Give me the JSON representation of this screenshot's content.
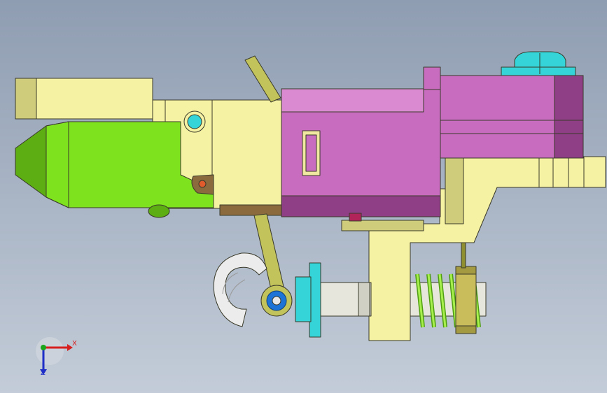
{
  "viewport": {
    "background_top": "#8f9db2",
    "background_bottom": "#c3ccd8"
  },
  "colors": {
    "yellow": "#f6f2a4",
    "yellow_dark": "#cfcc7c",
    "green": "#7fe21e",
    "green_dark": "#5cae12",
    "magenta": "#c86cbf",
    "magenta_dark": "#8e3f85",
    "magenta_light": "#d98ad1",
    "olive": "#c2c35a",
    "olive_dark": "#8f8f30",
    "cyan": "#34d4d8",
    "cyan_dark": "#1a9aa2",
    "brown": "#8b6a3e",
    "blue": "#1e74d6",
    "grey_light": "#ececec",
    "grey_mid": "#c5c5c5",
    "spring": "#7fd12a",
    "axis_x": "#d62020",
    "axis_y": "#1f2fc7",
    "axis_z": "#1aa51a"
  },
  "triad": {
    "x_label": "X",
    "y_label": "Z"
  }
}
